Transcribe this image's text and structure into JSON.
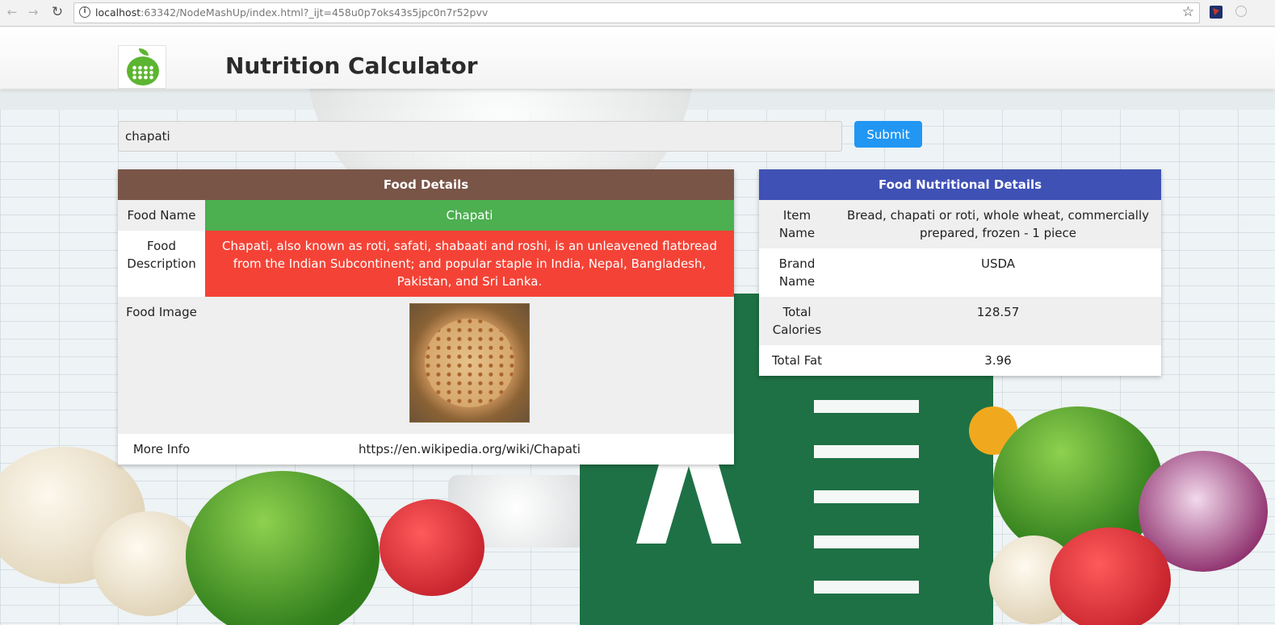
{
  "browser": {
    "url_host": "localhost",
    "url_rest": ":63342/NodeMashUp/index.html?_ijt=458u0p7oks43s5jpc0n7r52pvv"
  },
  "app": {
    "title": "Nutrition Calculator"
  },
  "search": {
    "value": "chapati",
    "submit_label": "Submit"
  },
  "food_details": {
    "header": "Food Details",
    "rows": {
      "name_label": "Food Name",
      "name_value": "Chapati",
      "description_label": "Food Description",
      "description_value": "Chapati, also known as roti, safati, shabaati and roshi, is an unleavened flatbread from the Indian Subcontinent; and popular staple in India, Nepal, Bangladesh, Pakistan, and Sri Lanka.",
      "image_label": "Food Image",
      "more_info_label": "More Info",
      "more_info_value": "https://en.wikipedia.org/wiki/Chapati"
    }
  },
  "nutrition_details": {
    "header": "Food Nutritional Details",
    "rows": [
      {
        "label": "Item Name",
        "value": "Bread, chapati or roti, whole wheat, commercially prepared, frozen - 1 piece"
      },
      {
        "label": "Brand Name",
        "value": "USDA"
      },
      {
        "label": "Total Calories",
        "value": "128.57"
      },
      {
        "label": "Total Fat",
        "value": "3.96"
      }
    ]
  },
  "colors": {
    "food_header": "#795548",
    "nutrition_header": "#3f51b5",
    "name_cell": "#4caf50",
    "description_cell": "#f44336",
    "submit_button": "#2196f3"
  }
}
